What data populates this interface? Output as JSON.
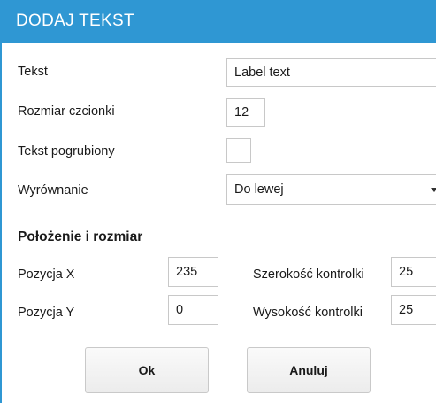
{
  "dialog": {
    "title": "DODAJ TEKST"
  },
  "form": {
    "text_label": "Tekst",
    "text_value": "Label text",
    "font_size_label": "Rozmiar czcionki",
    "font_size_value": "12",
    "bold_label": "Tekst pogrubiony",
    "bold_checked": false,
    "align_label": "Wyrównanie",
    "align_value": "Do lewej"
  },
  "position_size": {
    "section_title": "Położenie i rozmiar",
    "pos_x_label": "Pozycja X",
    "pos_x_value": "235",
    "pos_y_label": "Pozycja Y",
    "pos_y_value": "0",
    "width_label": "Szerokość kontrolki",
    "width_value": "25",
    "height_label": "Wysokość kontrolki",
    "height_value": "25"
  },
  "buttons": {
    "ok_label": "Ok",
    "cancel_label": "Anuluj"
  },
  "colors": {
    "accent": "#2f97d3"
  }
}
